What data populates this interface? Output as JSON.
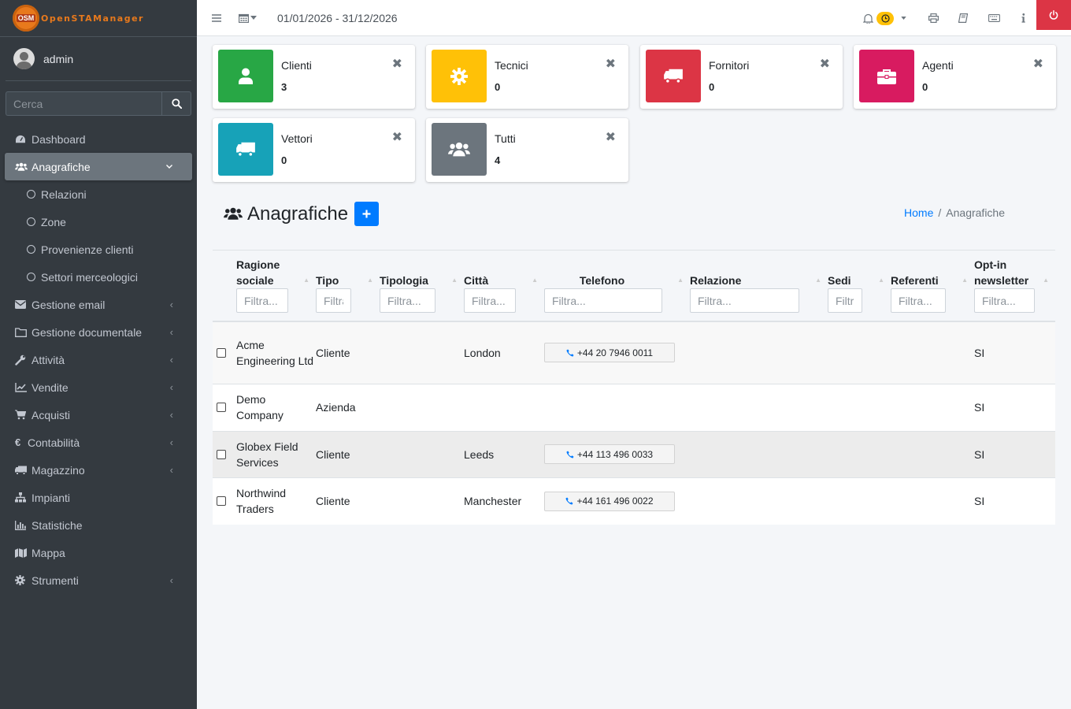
{
  "app": {
    "brand": "OpenSTAManager",
    "logo_text": "OSM"
  },
  "user": {
    "name": "admin"
  },
  "sidebar": {
    "search_placeholder": "Cerca",
    "items": [
      {
        "label": "Dashboard",
        "icon": "dashboard-icon"
      },
      {
        "label": "Anagrafiche",
        "icon": "users-icon",
        "active": true
      },
      {
        "label": "Relazioni",
        "sub": true
      },
      {
        "label": "Zone",
        "sub": true
      },
      {
        "label": "Provenienze clienti",
        "sub": true
      },
      {
        "label": "Settori merceologici",
        "sub": true
      },
      {
        "label": "Gestione email",
        "icon": "envelope-icon"
      },
      {
        "label": "Gestione documentale",
        "icon": "folder-icon"
      },
      {
        "label": "Attività",
        "icon": "wrench-icon"
      },
      {
        "label": "Vendite",
        "icon": "chart-line-icon"
      },
      {
        "label": "Acquisti",
        "icon": "cart-icon"
      },
      {
        "label": "Contabilità",
        "icon": "euro-icon"
      },
      {
        "label": "Magazzino",
        "icon": "truck-icon"
      },
      {
        "label": "Impianti",
        "icon": "sitemap-icon"
      },
      {
        "label": "Statistiche",
        "icon": "bar-chart-icon"
      },
      {
        "label": "Mappa",
        "icon": "map-icon"
      },
      {
        "label": "Strumenti",
        "icon": "cog-icon"
      }
    ]
  },
  "topbar": {
    "date_range": "01/01/2026 - 31/12/2026"
  },
  "info_boxes": [
    {
      "label": "Clienti",
      "count": "3",
      "color": "#28a745",
      "icon": "user-icon"
    },
    {
      "label": "Tecnici",
      "count": "0",
      "color": "#ffc107",
      "icon": "cog-icon"
    },
    {
      "label": "Fornitori",
      "count": "0",
      "color": "#dc3545",
      "icon": "truck-icon"
    },
    {
      "label": "Agenti",
      "count": "0",
      "color": "#d81b60",
      "icon": "briefcase-icon"
    },
    {
      "label": "Vettori",
      "count": "0",
      "color": "#17a2b8",
      "icon": "truck-icon"
    },
    {
      "label": "Tutti",
      "count": "4",
      "color": "#6c757d",
      "icon": "users-icon"
    }
  ],
  "page": {
    "title": "Anagrafiche"
  },
  "breadcrumb": {
    "home": "Home",
    "current": "Anagrafiche"
  },
  "table": {
    "filter_placeholder": "Filtra...",
    "columns": [
      {
        "label_1": "Ragione",
        "label_2": "sociale"
      },
      {
        "label_1": "",
        "label_2": "Tipo"
      },
      {
        "label_1": "",
        "label_2": "Tipologia"
      },
      {
        "label_1": "",
        "label_2": "Città"
      },
      {
        "label_1": "",
        "label_2": "Telefono"
      },
      {
        "label_1": "",
        "label_2": "Relazione"
      },
      {
        "label_1": "",
        "label_2": "Sedi"
      },
      {
        "label_1": "",
        "label_2": "Referenti"
      },
      {
        "label_1": "Opt-in",
        "label_2": "newsletter"
      }
    ],
    "rows": [
      {
        "name": "Acme Engineering Ltd",
        "tipo": "Cliente",
        "tipologia": "",
        "citta": "London",
        "telefono": "+44 20 7946 0011",
        "relazione": "",
        "sedi": "",
        "referenti": "",
        "optin": "SI"
      },
      {
        "name": "Demo Company",
        "tipo": "Azienda",
        "tipologia": "",
        "citta": "",
        "telefono": "",
        "relazione": "",
        "sedi": "",
        "referenti": "",
        "optin": "SI"
      },
      {
        "name": "Globex Field Services",
        "tipo": "Cliente",
        "tipologia": "",
        "citta": "Leeds",
        "telefono": "+44 113 496 0033",
        "relazione": "",
        "sedi": "",
        "referenti": "",
        "optin": "SI"
      },
      {
        "name": "Northwind Traders",
        "tipo": "Cliente",
        "tipologia": "",
        "citta": "Manchester",
        "telefono": "+44 161 496 0022",
        "relazione": "",
        "sedi": "",
        "referenti": "",
        "optin": "SI"
      }
    ]
  }
}
